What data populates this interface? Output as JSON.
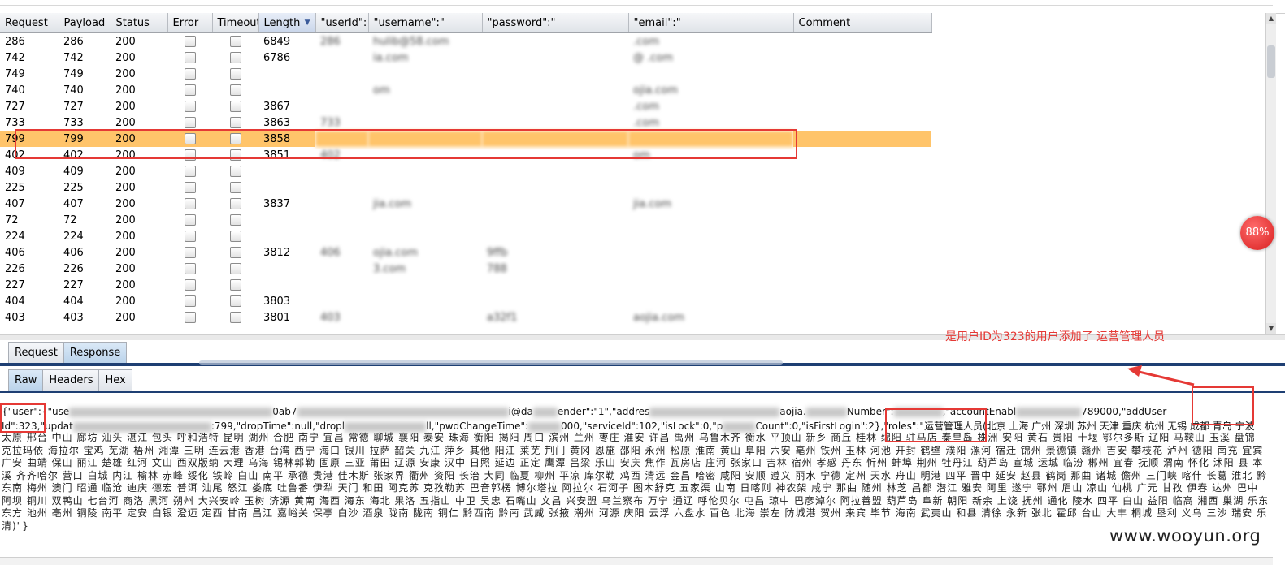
{
  "table": {
    "columns": [
      "Request",
      "Payload",
      "Status",
      "Error",
      "Timeout",
      "Length",
      "\"userId\":",
      "\"username\":\"",
      "\"password\":\"",
      "\"email\":\"",
      "Comment"
    ],
    "rows": [
      {
        "request": "286",
        "payload": "286",
        "status": "200",
        "length": "6849",
        "userid": "286",
        "username": "hulib@58.com",
        "password": "",
        "email": ".com"
      },
      {
        "request": "742",
        "payload": "742",
        "status": "200",
        "length": "6786",
        "userid": "",
        "username": "ia.com",
        "password": "",
        "email": "@ .com"
      },
      {
        "request": "749",
        "payload": "749",
        "status": "200",
        "length": "",
        "userid": "",
        "username": "",
        "password": "",
        "email": ""
      },
      {
        "request": "740",
        "payload": "740",
        "status": "200",
        "length": "",
        "userid": "",
        "username": "om",
        "password": "",
        "email": "ojia.com"
      },
      {
        "request": "727",
        "payload": "727",
        "status": "200",
        "length": "3867",
        "userid": "",
        "username": "",
        "password": "",
        "email": ".com"
      },
      {
        "request": "733",
        "payload": "733",
        "status": "200",
        "length": "3863",
        "userid": "733",
        "username": "",
        "password": "",
        "email": ".com"
      },
      {
        "request": "799",
        "payload": "799",
        "status": "200",
        "length": "3858",
        "userid": "",
        "username": "",
        "password": "",
        "email": ""
      },
      {
        "request": "402",
        "payload": "402",
        "status": "200",
        "length": "3851",
        "userid": "402",
        "username": "",
        "password": "",
        "email": "om"
      },
      {
        "request": "409",
        "payload": "409",
        "status": "200",
        "length": "",
        "userid": "",
        "username": "",
        "password": "",
        "email": ""
      },
      {
        "request": "225",
        "payload": "225",
        "status": "200",
        "length": "",
        "userid": "",
        "username": "",
        "password": "",
        "email": ""
      },
      {
        "request": "407",
        "payload": "407",
        "status": "200",
        "length": "3837",
        "userid": "",
        "username": "jia.com",
        "password": "",
        "email": "jia.com"
      },
      {
        "request": "72",
        "payload": "72",
        "status": "200",
        "length": "",
        "userid": "",
        "username": "",
        "password": "",
        "email": ""
      },
      {
        "request": "224",
        "payload": "224",
        "status": "200",
        "length": "",
        "userid": "",
        "username": "",
        "password": "",
        "email": ""
      },
      {
        "request": "406",
        "payload": "406",
        "status": "200",
        "length": "3812",
        "userid": "406",
        "username": "ojia.com",
        "password": "9ffb",
        "email": ""
      },
      {
        "request": "226",
        "payload": "226",
        "status": "200",
        "length": "",
        "userid": "",
        "username": "3.com",
        "password": "788",
        "email": ""
      },
      {
        "request": "227",
        "payload": "227",
        "status": "200",
        "length": "",
        "userid": "",
        "username": "",
        "password": "",
        "email": ""
      },
      {
        "request": "404",
        "payload": "404",
        "status": "200",
        "length": "3803",
        "userid": "",
        "username": "",
        "password": "",
        "email": ""
      },
      {
        "request": "403",
        "payload": "403",
        "status": "200",
        "length": "3801",
        "userid": "403",
        "username": "",
        "password": "a32f1",
        "email": "aojia.com"
      }
    ]
  },
  "tabs": {
    "request": "Request",
    "response": "Response"
  },
  "format_tabs": {
    "raw": "Raw",
    "headers": "Headers",
    "hex": "Hex"
  },
  "response": {
    "line1_a": "{\"user\":{\"use",
    "line1_b": "0ab7",
    "line1_c": "i@da",
    "line1_d": "ender\":\"1\",\"addres",
    "line1_e": "aojia.",
    "line1_f": "Number\":",
    "line1_g": ",\"accountEnabl",
    "line1_h": "789000,\"addUser",
    "line2_a": "Id\":323,\"updat",
    "line2_b": ":799,\"dropTime\":null,\"dropl",
    "line2_c": "ll,\"pwdChangeTime\":",
    "line2_d": "000,\"serviceId\":102,\"isLock\":0,\"p",
    "line2_e": "Count\":0,\"isFirstLogin\":2},\"roles\":\"运营管理人员(北京 上海 广州 深圳 苏州 天津 重庆 杭州 无锡 成都 青岛 宁波",
    "cities": "太原 邢台 中山 廊坊 汕头 湛江 包头 呼和浩特 昆明 湖州 合肥 南宁 宜昌 常德 聊城 襄阳 泰安 珠海 衡阳 揭阳 周口 滨州 兰州 枣庄 淮安 许昌 禹州 乌鲁木齐 衡水 平顶山 新乡 商丘 桂林 绵阳 驻马店 秦皇岛 株洲 安阳 黄石 贵阳 十堰 鄂尔多斯 辽阳 马鞍山 玉溪 盘锦 克拉玛依 海拉尔 宝鸡 芜湖 梧州 湘潭 三明 连云港 香港 台湾 西宁 海口 银川 拉萨 韶关 九江 萍乡 其他 阳江 莱芜 荆门 黄冈 恩施 邵阳 永州 松原 淮南 黄山 阜阳 六安 亳州 铁州 玉林 河池 开封 鹤壁 濮阳 漯河 宿迁 锦州 景德镇 赣州 吉安 攀枝花 泸州 德阳 南充 宜宾 广安 曲靖 保山 丽江 楚雄 红河 文山 西双版纳 大理 乌海 锡林郭勒 固原 三亚 莆田 辽源 安康 汉中 日照 延边 正定 鹰潭 吕梁 乐山 安庆 焦作 瓦房店 庄河 张家口 吉林 宿州 孝感 丹东 忻州 蚌埠 荆州 牡丹江 葫芦岛 宣城 运城 临汾 郴州 宜春 抚顺 渭南 怀化 沭阳 县 本溪 齐齐哈尔 营口 白城 内江 榆林 赤峰 绥化 铁岭 白山 南平 承德 贵港 佳木斯 张家界 衢州 资阳 长治 大同 临夏 柳州 平凉 库尔勒 鸡西 清远 金昌 哈密 咸阳 安顺 遵义 丽水 宁德 定州 天水 舟山 明港 四平 晋中 延安 赵县 鹤岗 那曲 诸城 儋州 三门峡 喀什 长葛 淮北 黔东南 梅州 澳门 昭通 临沧 迪庆 德宏 普洱 汕尾 怒江 娄底 吐鲁番 伊犁 天门 和田 阿克苏 克孜勒苏 巴音郭楞 博尔塔拉 阿拉尔 石河子 图木舒克 五家渠 山南 日喀则 神农架 咸宁 那曲 随州 林芝 昌都 潜江 雅安 阿里 遂宁 鄂州 眉山 凉山 仙桃 广元 甘孜 伊春 达州 巴中 阿坝 铜川 双鸭山 七台河 商洛 黑河 朔州 大兴安岭 玉树 济源 黄南 海西 海东 海北 果洛 五指山 中卫 吴忠 石嘴山 文昌 兴安盟 乌兰察布 万宁 通辽 呼伦贝尔 屯昌 琼中 巴彦淖尔 阿拉善盟 葫芦岛 阜新 朝阳 新余 上饶 抚州 通化 陵水 四平 白山 益阳 临高 湘西 巢湖 乐东 东方 池州 亳州 铜陵 南平 定安 白银 澄迈 定西 甘南 昌江 嘉峪关 保亭 白沙 酒泉 陇南 陇南 铜仁 黔西南 黔南 武威 张掖 潮州 河源 庆阳 云浮 六盘水 百色 北海 崇左 防城港 贺州 来宾 毕节 海南 武夷山 和县 清徐 永新 张北 霍邱 台山 大丰 桐城 垦利 义乌 三沙 瑞安 乐清)\"}"
  },
  "annotation": "是用户ID为323的用户添加了 运营管理人员",
  "percent_badge": "88%",
  "watermark": "www.wooyun.org"
}
